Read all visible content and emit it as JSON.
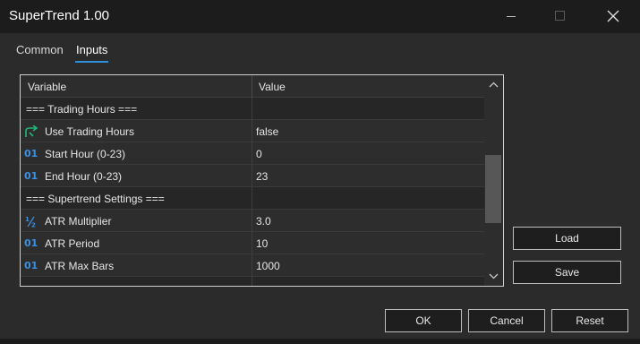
{
  "window": {
    "title": "SuperTrend 1.00"
  },
  "tabs": [
    {
      "label": "Common",
      "active": false
    },
    {
      "label": "Inputs",
      "active": true
    }
  ],
  "grid": {
    "headers": {
      "variable": "Variable",
      "value": "Value"
    },
    "rows": [
      {
        "name": "=== Trading Hours ===",
        "value": "",
        "icon": "",
        "section": true
      },
      {
        "name": "Use Trading Hours",
        "value": "false",
        "icon": "bool-arrow-icon",
        "section": false
      },
      {
        "name": "Start Hour (0-23)",
        "value": "0",
        "icon": "integer-icon",
        "section": false
      },
      {
        "name": "End Hour (0-23)",
        "value": "23",
        "icon": "integer-icon",
        "section": false
      },
      {
        "name": "=== Supertrend Settings ===",
        "value": "",
        "icon": "",
        "section": true
      },
      {
        "name": "ATR Multiplier",
        "value": "3.0",
        "icon": "double-icon",
        "section": false
      },
      {
        "name": "ATR Period",
        "value": "10",
        "icon": "integer-icon",
        "section": false
      },
      {
        "name": "ATR Max Bars",
        "value": "1000",
        "icon": "integer-icon",
        "section": false
      }
    ],
    "scroll_position": 0.42
  },
  "buttons": {
    "load": "Load",
    "save": "Save",
    "ok": "OK",
    "cancel": "Cancel",
    "reset": "Reset"
  },
  "colors": {
    "accent": "#2f8fd8",
    "bool_icon": "#1fb87a",
    "integer_icon": "#3d8fe0"
  }
}
